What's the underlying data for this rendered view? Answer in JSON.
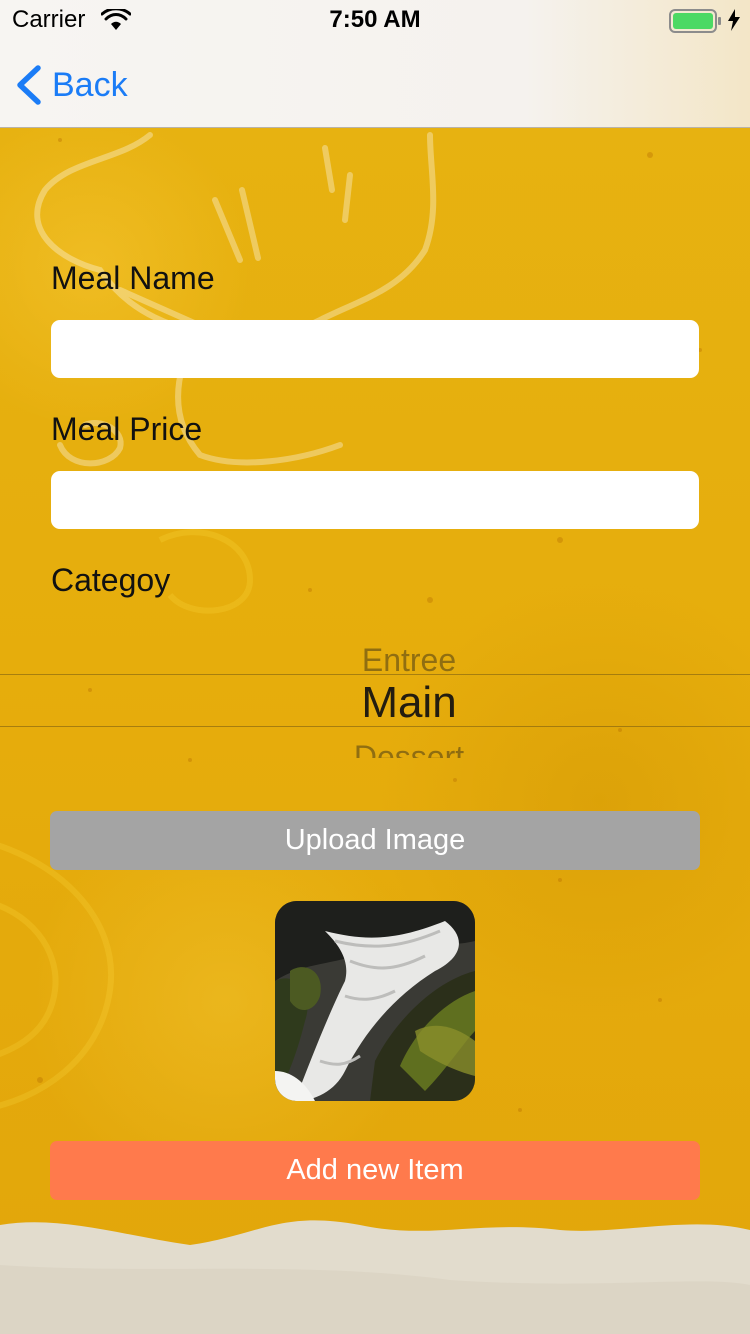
{
  "status_bar": {
    "carrier": "Carrier",
    "time": "7:50 AM"
  },
  "nav": {
    "back_label": "Back"
  },
  "form": {
    "meal_name_label": "Meal Name",
    "meal_name_value": "",
    "meal_price_label": "Meal Price",
    "meal_price_value": "",
    "category_label": "Categoy",
    "category_picker": {
      "above": "Entree",
      "selected": "Main",
      "below": "Dessert"
    },
    "upload_button": "Upload Image",
    "add_button": "Add new Item"
  },
  "colors": {
    "accent_link": "#1b7cf6",
    "upload_button": "#a4a4a4",
    "add_button": "#ff7a4c",
    "background": "#e7b312"
  }
}
